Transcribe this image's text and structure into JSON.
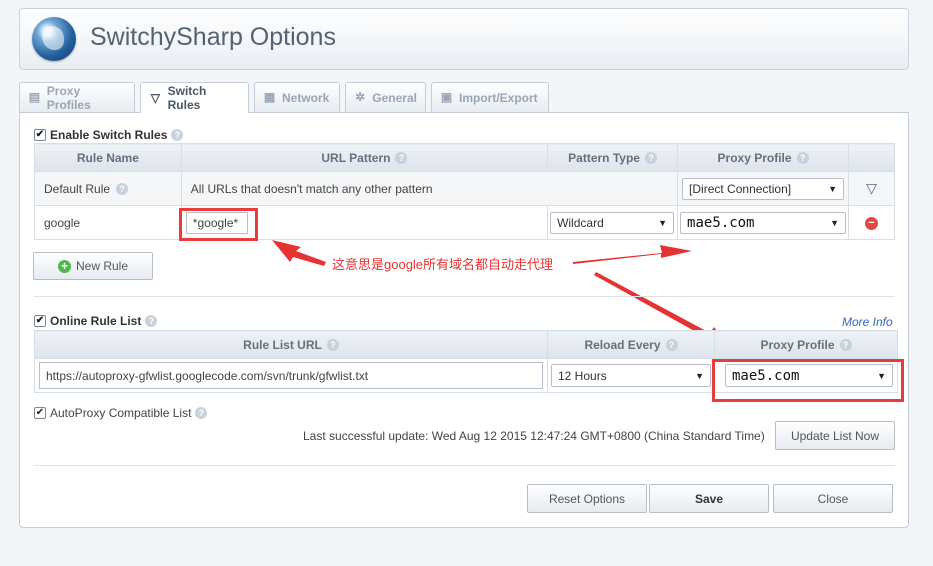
{
  "app": {
    "title": "SwitchySharp Options"
  },
  "tabs": [
    {
      "label": "Proxy Profiles",
      "icon": "profile-icon"
    },
    {
      "label": "Switch Rules",
      "icon": "filter-icon"
    },
    {
      "label": "Network",
      "icon": "network-icon"
    },
    {
      "label": "General",
      "icon": "gear-icon"
    },
    {
      "label": "Import/Export",
      "icon": "save-icon"
    }
  ],
  "switch_rules": {
    "enable_label": "Enable Switch Rules",
    "headers": {
      "rule_name": "Rule Name",
      "url_pattern": "URL Pattern",
      "pattern_type": "Pattern Type",
      "proxy_profile": "Proxy Profile"
    },
    "default_rule": {
      "name": "Default Rule",
      "description": "All URLs that doesn't match any other pattern",
      "profile": "[Direct Connection]"
    },
    "rules": [
      {
        "name": "google",
        "pattern": "*google*",
        "type": "Wildcard",
        "profile": "mae5.com"
      }
    ],
    "new_rule_label": "New Rule"
  },
  "online_rule_list": {
    "enable_label": "Online Rule List",
    "more_info": "More Info",
    "headers": {
      "url": "Rule List URL",
      "reload": "Reload Every",
      "profile": "Proxy Profile"
    },
    "url": "https://autoproxy-gfwlist.googlecode.com/svn/trunk/gfwlist.txt",
    "reload": "12 Hours",
    "profile": "mae5.com",
    "autoproxy_label": "AutoProxy Compatible List",
    "last_update": "Last successful update: Wed Aug 12 2015 12:47:24 GMT+0800 (China Standard Time)",
    "update_button": "Update List Now"
  },
  "footer": {
    "reset": "Reset Options",
    "save": "Save",
    "close": "Close"
  },
  "annotation": {
    "text": "这意思是google所有域名都自动走代理",
    "color": "#e53333"
  }
}
